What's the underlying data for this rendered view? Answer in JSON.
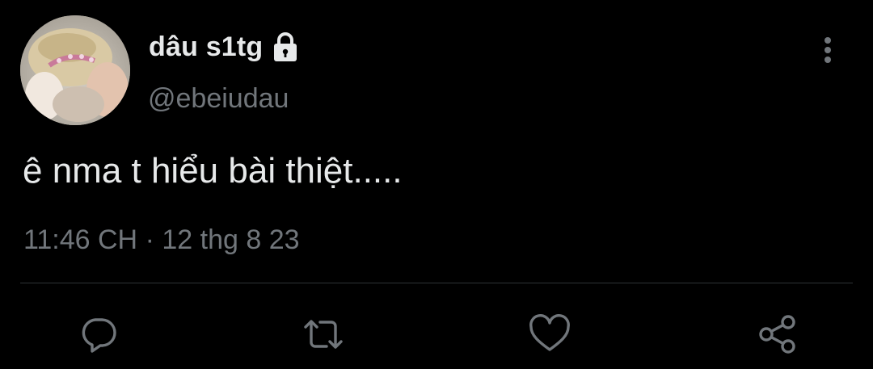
{
  "user": {
    "display_name": "dâu s1tg",
    "handle": "@ebeiudau",
    "protected_icon": "lock-icon",
    "avatar_icon": "avatar-photo"
  },
  "tweet": {
    "text": "ê nma t hiểu bài thiệt.....",
    "time": "11:46 CH",
    "separator": "·",
    "date": "12 thg 8 23"
  },
  "menu": {
    "more_icon": "more-vertical-icon"
  },
  "actions": [
    {
      "icon": "reply-icon"
    },
    {
      "icon": "retweet-icon"
    },
    {
      "icon": "like-icon"
    },
    {
      "icon": "share-icon"
    }
  ],
  "colors": {
    "background": "#000000",
    "primary_text": "#e7e9ea",
    "secondary_text": "#71767b",
    "divider": "#2f3336"
  }
}
